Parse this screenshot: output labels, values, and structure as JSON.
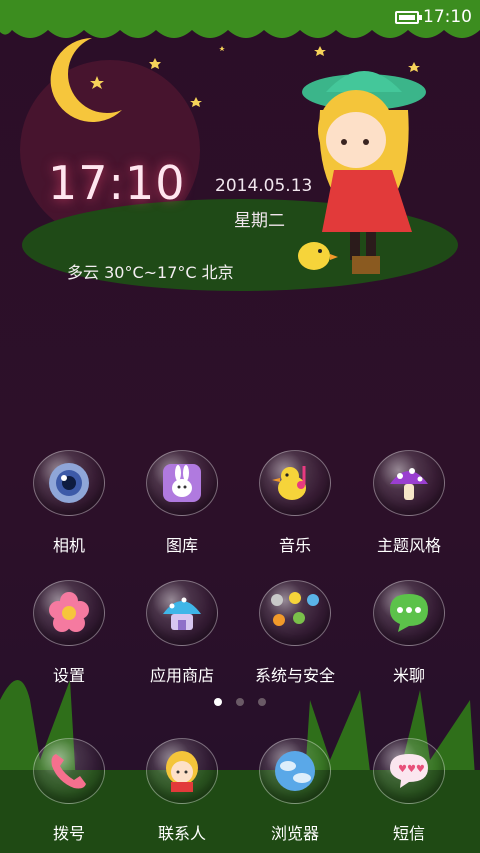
{
  "status_bar": {
    "time": "17:10",
    "battery_icon": "battery-full-icon"
  },
  "clock_widget": {
    "time": "17:10",
    "date": "2014.05.13",
    "weekday": "星期二",
    "weather": "多云 30°C~17°C 北京"
  },
  "apps": [
    {
      "label": "相机",
      "icon": "camera-icon"
    },
    {
      "label": "图库",
      "icon": "gallery-icon"
    },
    {
      "label": "音乐",
      "icon": "music-icon"
    },
    {
      "label": "主题风格",
      "icon": "theme-icon"
    },
    {
      "label": "设置",
      "icon": "settings-icon"
    },
    {
      "label": "应用商店",
      "icon": "app-store-icon"
    },
    {
      "label": "系统与安全",
      "icon": "system-security-icon"
    },
    {
      "label": "米聊",
      "icon": "miliao-icon"
    }
  ],
  "pager": {
    "pages": 3,
    "current": 1
  },
  "dock": [
    {
      "label": "拨号",
      "icon": "phone-icon"
    },
    {
      "label": "联系人",
      "icon": "contacts-icon"
    },
    {
      "label": "浏览器",
      "icon": "browser-icon"
    },
    {
      "label": "短信",
      "icon": "messages-icon"
    }
  ],
  "colors": {
    "background": "#2b0e28",
    "grass": "#2f6f1a",
    "label": "#ffffff"
  }
}
